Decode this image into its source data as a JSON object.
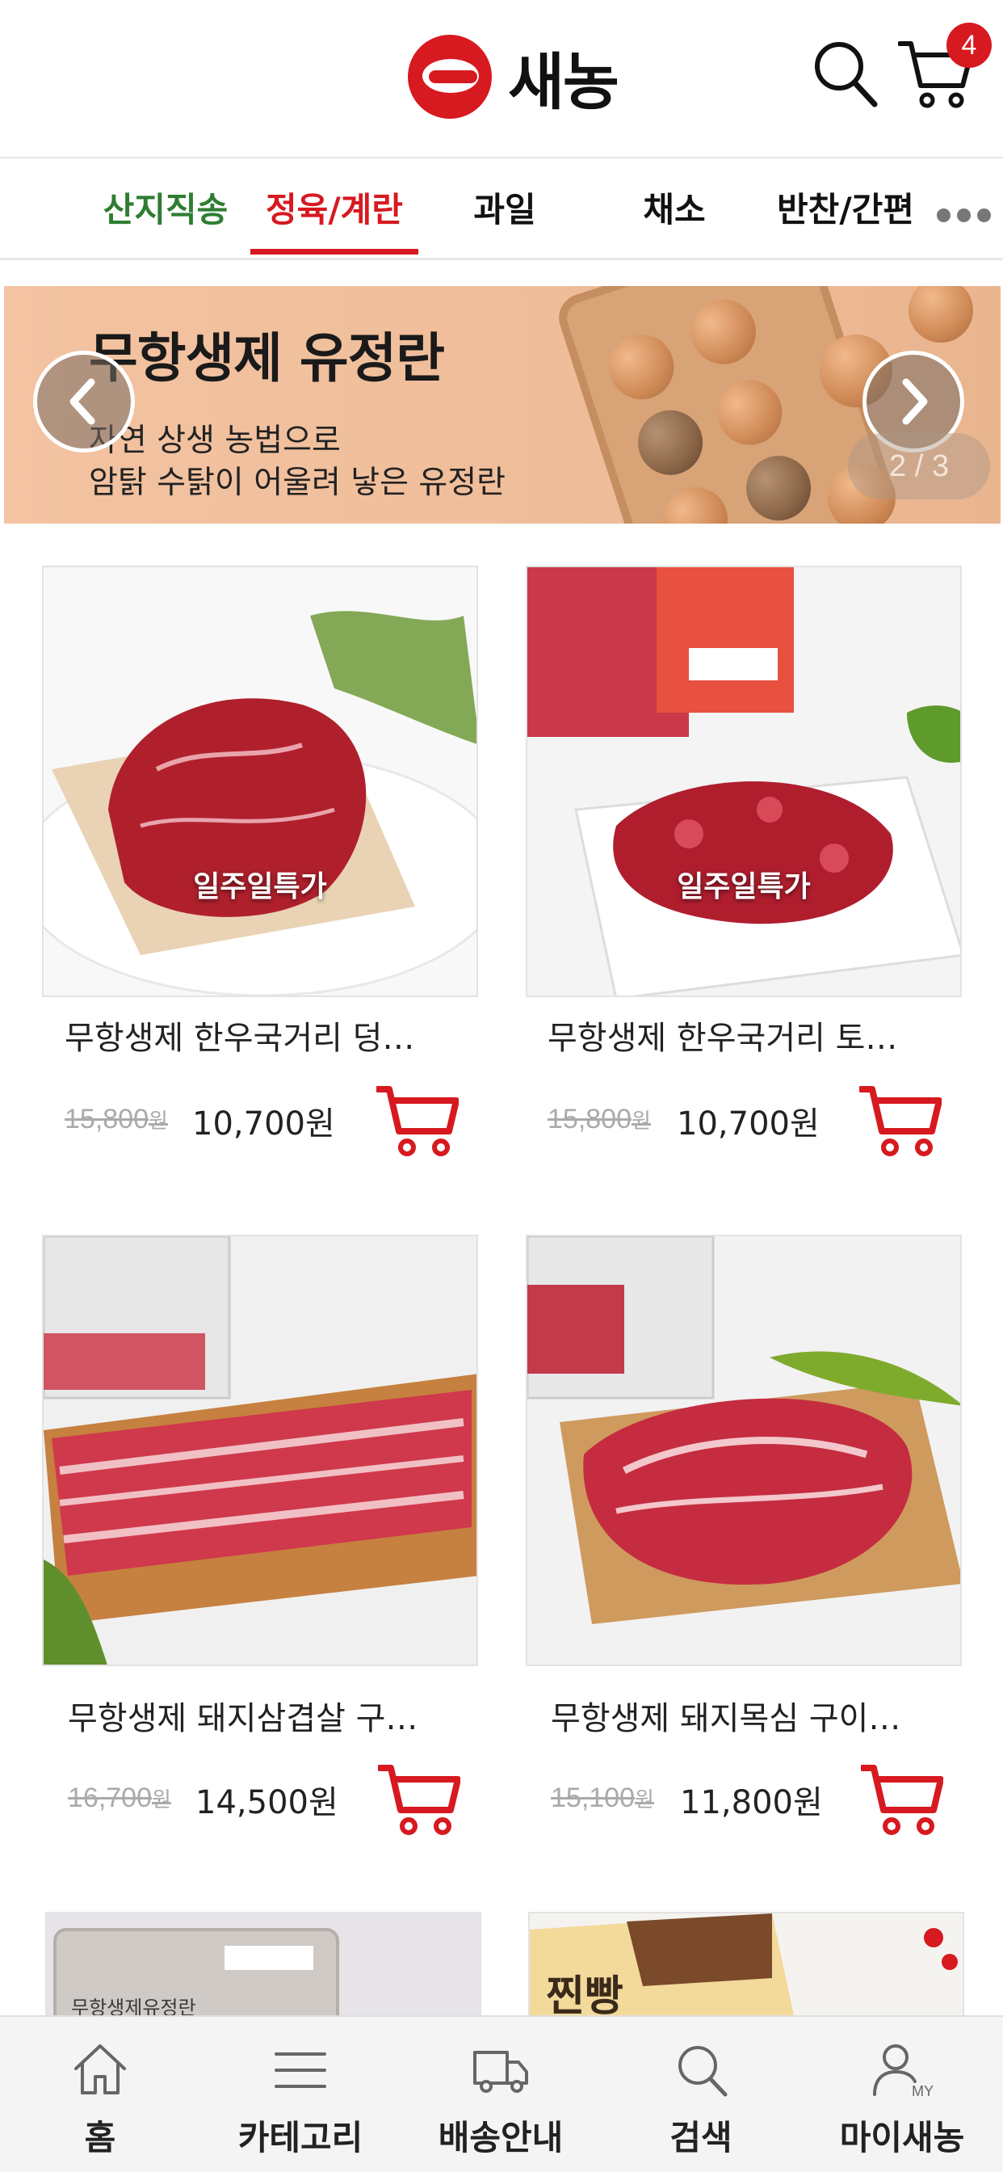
{
  "header": {
    "logo_text": "새농",
    "cart_count": "4",
    "brand_color": "#d71920",
    "icons": {
      "search": "search-icon",
      "cart": "cart-icon"
    }
  },
  "tabs": [
    {
      "label": "산지직송",
      "color": "#2e7d32"
    },
    {
      "label": "정육/계란",
      "active": true
    },
    {
      "label": "과일"
    },
    {
      "label": "채소"
    },
    {
      "label": "반찬/간편"
    }
  ],
  "banner": {
    "title": "무항생제 유정란",
    "subtitle_line1": "자연 상생 농법으로",
    "subtitle_line2": "암탉 수탉이 어울려 낳은 유정란",
    "counter": "2 / 3"
  },
  "products": [
    {
      "name": "무항생제 한우국거리 덩…",
      "badge": "일주일특가",
      "old_price": "15,800",
      "old_unit": "원",
      "price": "10,700원"
    },
    {
      "name": "무항생제 한우국거리 토…",
      "badge": "일주일특가",
      "old_price": "15,800",
      "old_unit": "원",
      "price": "10,700원"
    },
    {
      "name": "무항생제 돼지삼겹살 구…",
      "old_price": "16,700",
      "old_unit": "원",
      "price": "14,500원"
    },
    {
      "name": "무항생제 돼지목심 구이…",
      "old_price": "15,100",
      "old_unit": "원",
      "price": "11,800원"
    }
  ],
  "partial_products": {
    "left_label": "무항생제유정란",
    "right_label": "찐빵"
  },
  "bottom_nav": [
    {
      "label": "홈",
      "icon": "home-icon"
    },
    {
      "label": "카테고리",
      "icon": "menu-icon"
    },
    {
      "label": "배송안내",
      "icon": "truck-icon"
    },
    {
      "label": "검색",
      "icon": "search-icon"
    },
    {
      "label": "마이새농",
      "icon": "user-icon",
      "icon_text": "MY"
    }
  ]
}
